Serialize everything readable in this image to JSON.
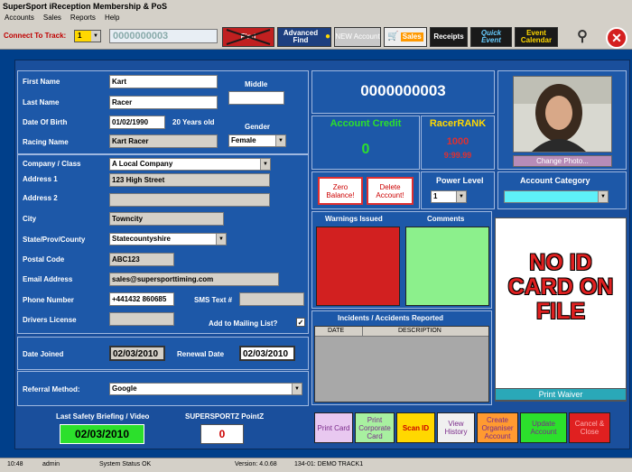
{
  "window": {
    "title": "SuperSport iReception Membership & PoS"
  },
  "menu": [
    "Accounts",
    "Sales",
    "Reports",
    "Help"
  ],
  "toolbar": {
    "track_label": "Connect To Track:",
    "track_value": "1",
    "account_field": "0000000003",
    "find_label": "Find",
    "advanced_find_label": "Advanced Find",
    "new_account_label": "NEW Account",
    "sales_label": "Sales",
    "receipts_label": "Receipts",
    "quick_event_label": "Quick Event",
    "event_calendar_label": "Event Calendar"
  },
  "form": {
    "first_name_label": "First Name",
    "first_name": "Kart",
    "last_name_label": "Last Name",
    "last_name": "Racer",
    "middle_label": "Middle",
    "middle": "",
    "dob_label": "Date Of Birth",
    "dob": "01/02/1990",
    "age": "20 Years old",
    "gender_label": "Gender",
    "gender": "Female",
    "racing_name_label": "Racing Name",
    "racing_name": "Kart Racer",
    "company_label": "Company / Class",
    "company": "A Local Company",
    "address1_label": "Address 1",
    "address1": "123 High Street",
    "address2_label": "Address 2",
    "address2": "",
    "city_label": "City",
    "city": "Towncity",
    "state_label": "State/Prov/County",
    "state": "Statecountyshire",
    "postal_label": "Postal Code",
    "postal": "ABC123",
    "email_label": "Email Address",
    "email": "sales@supersporttiming.com",
    "phone_label": "Phone Number",
    "phone": "+441432 860685",
    "sms_label": "SMS Text #",
    "sms": "",
    "license_label": "Drivers License",
    "license": "",
    "mailing_label": "Add to Mailing List?",
    "mailing_check": "✓",
    "joined_label": "Date Joined",
    "joined": "02/03/2010",
    "renewal_label": "Renewal Date",
    "renewal": "02/03/2010",
    "referral_label": "Referral Method:",
    "referral": "Google",
    "safety_label": "Last Safety Briefing / Video",
    "safety": "02/03/2010",
    "pointz_label": "SUPERSPORTZ PointZ",
    "pointz": "0"
  },
  "account": {
    "number": "0000000003",
    "credit_label": "Account Credit",
    "credit": "0",
    "rank_label": "RacerRANK",
    "rank": "1000",
    "rank_time": "9:99.99",
    "zero_balance": "Zero Balance!",
    "delete_account": "Delete Account!",
    "power_label": "Power Level",
    "power": "1",
    "category_label": "Account Category",
    "category": "",
    "warnings_label": "Warnings Issued",
    "comments_label": "Comments",
    "incidents_label": "Incidents / Accidents Reported",
    "col_date": "DATE",
    "col_desc": "DESCRIPTION",
    "change_photo": "Change Photo...",
    "no_id": "NO ID CARD ON FILE",
    "print_waiver": "Print Waiver"
  },
  "actions": {
    "print_card": "Print Card",
    "print_corp": "Print Corporate Card",
    "scan_id": "Scan ID",
    "view_history": "View History",
    "create_organiser": "Create Organiser Account",
    "update_account": "Update Account",
    "cancel_close": "Cancel & Close"
  },
  "status": {
    "time": "10:48",
    "user": "admin",
    "system": "System Status OK",
    "version": "Version: 4.0.68",
    "track": "134-01: DEMO TRACK1"
  }
}
